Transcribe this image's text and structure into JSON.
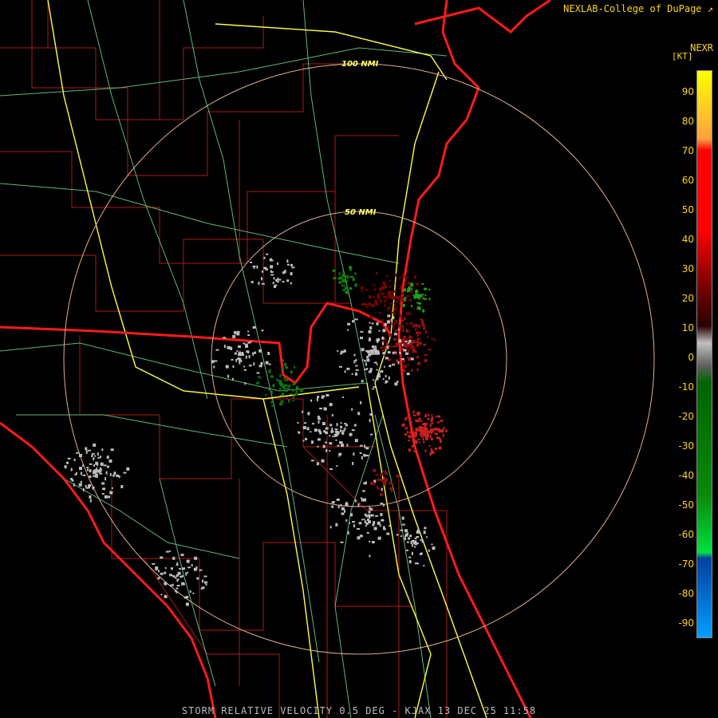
{
  "credit": "NEXLAB-College of DuPage",
  "product": "NEXR",
  "units": "[KT]",
  "footer": "STORM RELATIVE VELOCITY 0.5 DEG - KJAX 13 DEC 25 11:58",
  "rings": [
    {
      "label": "50 NMI"
    },
    {
      "label": "100 NMI"
    }
  ],
  "legend": {
    "ticks": [
      "90",
      "80",
      "70",
      "60",
      "50",
      "40",
      "30",
      "20",
      "10",
      "0",
      "-10",
      "-20",
      "-30",
      "-40",
      "-50",
      "-60",
      "-70",
      "-80",
      "-90"
    ],
    "colors": {
      "high_yellow": "#ffff00",
      "orange": "#ffa040",
      "red": "#ff0000",
      "dark_red": "#7a0000",
      "gray": "#c0c0c0",
      "dark_green": "#006400",
      "green": "#00e040",
      "dark_blue": "#0040a0",
      "blue": "#00a0ff"
    }
  },
  "colors": {
    "state_lines": "#ff1a1a",
    "county_lines": "#b01818",
    "highways": "#ffff40",
    "roads": "#70d890",
    "range_rings": "#e0b090",
    "background": "#000000"
  }
}
